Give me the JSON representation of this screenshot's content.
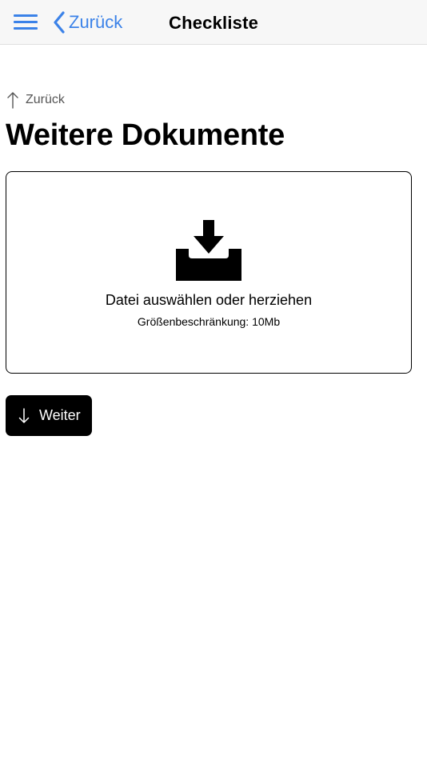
{
  "navbar": {
    "back_label": "Zurück",
    "title": "Checkliste"
  },
  "main": {
    "back_link_label": "Zurück",
    "title": "Weitere Dokumente",
    "dropzone": {
      "primary_text": "Datei auswählen oder herziehen",
      "size_limit_text": "Größenbeschränkung: 10Mb"
    },
    "next_button_label": "Weiter"
  },
  "colors": {
    "accent": "#3b82e8",
    "navbar_background": "#f7f7f7",
    "button_background": "#000000"
  },
  "icons": {
    "menu": "hamburger-icon",
    "back": "chevron-left-icon",
    "up": "arrow-up-icon",
    "upload": "inbox-download-icon",
    "down": "arrow-down-icon"
  }
}
